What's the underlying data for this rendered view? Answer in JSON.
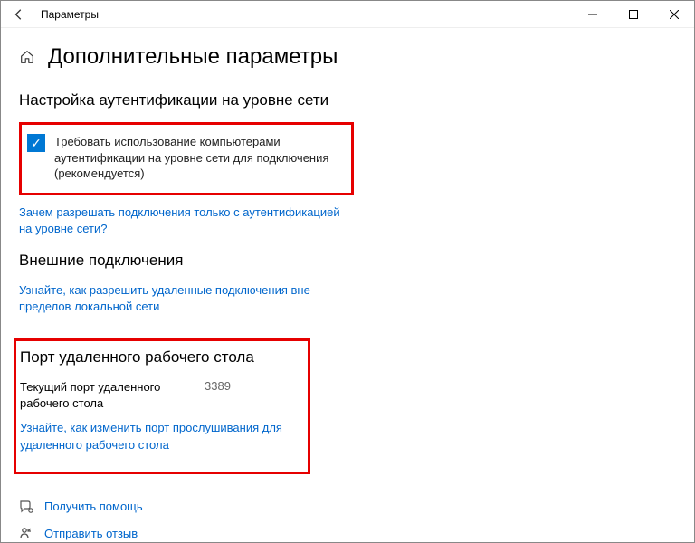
{
  "window": {
    "title": "Параметры"
  },
  "page": {
    "title": "Дополнительные параметры"
  },
  "auth_section": {
    "title": "Настройка аутентификации на уровне сети",
    "checkbox_label": "Требовать использование компьютерами аутентификации на уровне сети для подключения (рекомендуется)",
    "link": "Зачем разрешать подключения только с аутентификацией на уровне сети?"
  },
  "external_section": {
    "title": "Внешние подключения",
    "link": "Узнайте, как разрешить удаленные подключения вне пределов локальной сети"
  },
  "port_section": {
    "title": "Порт удаленного рабочего стола",
    "port_label": "Текущий порт удаленного рабочего стола",
    "port_value": "3389",
    "link": "Узнайте, как изменить порт прослушивания для удаленного рабочего стола"
  },
  "footer": {
    "help": "Получить помощь",
    "feedback": "Отправить отзыв"
  }
}
